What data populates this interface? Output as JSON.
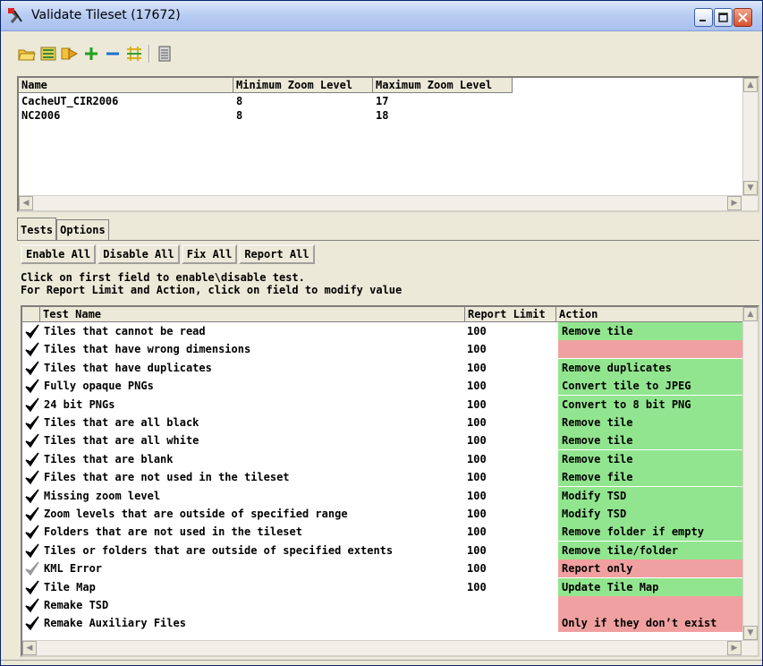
{
  "window": {
    "title": "Validate Tileset (17672)"
  },
  "toolbar": {
    "buttons": [
      {
        "name": "open-folder-icon"
      },
      {
        "name": "import-icon"
      },
      {
        "name": "forward-icon"
      },
      {
        "name": "add-icon"
      },
      {
        "name": "remove-icon"
      },
      {
        "name": "grid-icon"
      },
      {
        "name": "document-icon"
      }
    ]
  },
  "tileset_list": {
    "columns": [
      "Name",
      "Minimum Zoom Level",
      "Maximum Zoom Level"
    ],
    "rows": [
      {
        "name": "CacheUT_CIR2006",
        "min": "8",
        "max": "17"
      },
      {
        "name": "NC2006",
        "min": "8",
        "max": "18"
      }
    ]
  },
  "tabs": [
    {
      "label": "Tests",
      "active": true
    },
    {
      "label": "Options",
      "active": false
    }
  ],
  "actions": {
    "enable_all": "Enable All",
    "disable_all": "Disable All",
    "fix_all": "Fix All",
    "report_all": "Report All"
  },
  "instructions": {
    "line1": "Click on first field to enable\\disable test.",
    "line2": "For Report Limit and Action, click on field to modify value"
  },
  "tests_table": {
    "columns": [
      "Test Name",
      "Report Limit",
      "Action"
    ],
    "rows": [
      {
        "name": "Tiles that cannot be read",
        "limit": "100",
        "action": "Remove tile",
        "status": "green",
        "checked": true
      },
      {
        "name": "Tiles that have wrong dimensions",
        "limit": "100",
        "action": "",
        "status": "red",
        "checked": true
      },
      {
        "name": "Tiles that have duplicates",
        "limit": "100",
        "action": "Remove duplicates",
        "status": "green",
        "checked": true
      },
      {
        "name": "Fully opaque PNGs",
        "limit": "100",
        "action": "Convert tile to JPEG",
        "status": "green",
        "checked": true
      },
      {
        "name": "24 bit PNGs",
        "limit": "100",
        "action": "Convert to 8 bit PNG",
        "status": "green",
        "checked": true
      },
      {
        "name": "Tiles that are all black",
        "limit": "100",
        "action": "Remove tile",
        "status": "green",
        "checked": true
      },
      {
        "name": "Tiles that are all white",
        "limit": "100",
        "action": "Remove tile",
        "status": "green",
        "checked": true
      },
      {
        "name": "Tiles that are blank",
        "limit": "100",
        "action": "Remove tile",
        "status": "green",
        "checked": true
      },
      {
        "name": "Files that are not used in the tileset",
        "limit": "100",
        "action": "Remove file",
        "status": "green",
        "checked": true
      },
      {
        "name": "Missing zoom level",
        "limit": "100",
        "action": "Modify TSD",
        "status": "green",
        "checked": true
      },
      {
        "name": "Zoom levels that are outside of specified range",
        "limit": "100",
        "action": "Modify TSD",
        "status": "green",
        "checked": true
      },
      {
        "name": "Folders that are not used in the tileset",
        "limit": "100",
        "action": "Remove folder if empty",
        "status": "green",
        "checked": true
      },
      {
        "name": "Tiles or folders that are outside of specified extents",
        "limit": "100",
        "action": "Remove tile/folder",
        "status": "green",
        "checked": true
      },
      {
        "name": "KML Error",
        "limit": "100",
        "action": "Report only",
        "status": "red",
        "checked": false
      },
      {
        "name": "Tile Map",
        "limit": "100",
        "action": "Update Tile Map",
        "status": "green",
        "checked": true
      },
      {
        "name": "Remake TSD",
        "limit": "",
        "action": "",
        "status": "red",
        "checked": true
      },
      {
        "name": "Remake Auxiliary Files",
        "limit": "",
        "action": "Only if they don’t exist",
        "status": "red",
        "checked": true
      }
    ]
  },
  "colors": {
    "green": "#92e58f",
    "red": "#f0a0a0",
    "check": "#000000",
    "check_disabled": "#9a9a9a"
  }
}
